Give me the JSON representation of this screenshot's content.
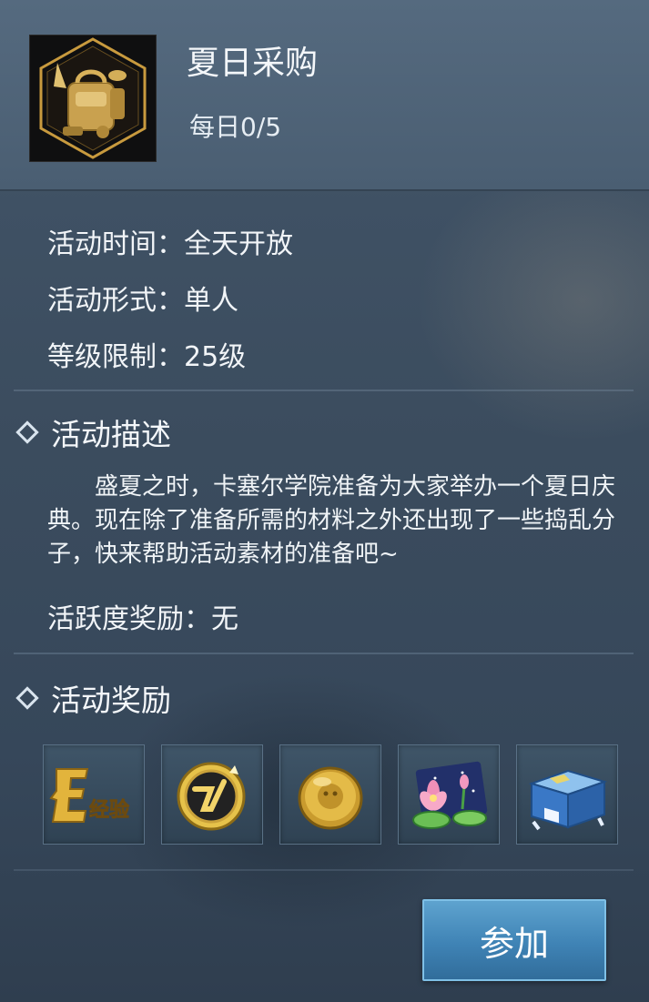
{
  "activity": {
    "title": "夏日采购",
    "daily_progress": "每日0/5",
    "time": "活动时间：全天开放",
    "format": "活动形式：单人",
    "level": "等级限制：25级",
    "icon": "backpack-icon"
  },
  "description": {
    "heading": "活动描述",
    "text": "　　盛夏之时，卡塞尔学院准备为大家举办一个夏日庆典。现在除了准备所需的材料之外还出现了一些捣乱分子，快来帮助活动素材的准备吧~",
    "activity_reward": "活跃度奖励：无"
  },
  "rewards": {
    "heading": "活动奖励",
    "items": [
      {
        "icon": "exp-icon",
        "label": "经验"
      },
      {
        "icon": "coin-icon"
      },
      {
        "icon": "gold-coin-icon"
      },
      {
        "icon": "lotus-icon"
      },
      {
        "icon": "treasure-chest-icon"
      }
    ]
  },
  "join_button": "参加",
  "colors": {
    "panel": "#3b4c5e",
    "accent_button": "#4a8fc0",
    "icon_gold": "#d8b15a"
  }
}
